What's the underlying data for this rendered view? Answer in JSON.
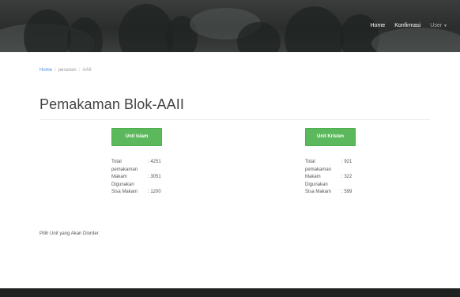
{
  "nav": {
    "home": "Home",
    "konfirmasi": "Konfirmasi",
    "user": "User"
  },
  "breadcrumb": [
    "Home",
    "pesanan",
    "AAII"
  ],
  "page_title": "Pemakaman Blok-AAII",
  "units": [
    {
      "button_label": "Unit Islam",
      "stats": [
        {
          "label": "Total pemakaman",
          "value": "4251"
        },
        {
          "label": "Makam Digunakan",
          "value": "3051"
        },
        {
          "label": "Sisa Makam",
          "value": "1200"
        }
      ]
    },
    {
      "button_label": "Unit Kristen",
      "stats": [
        {
          "label": "Total pemakaman",
          "value": "921"
        },
        {
          "label": "Makam Digunakan",
          "value": "322"
        },
        {
          "label": "Sisa Makam",
          "value": "599"
        }
      ]
    }
  ],
  "instruction": "Pilih Unit yang Akan Diorder",
  "colors": {
    "accent_green": "#5cb85c",
    "link_blue": "#4d8dd6",
    "header_dark": "#2a2d2c",
    "footer_dark": "#1f2121"
  }
}
